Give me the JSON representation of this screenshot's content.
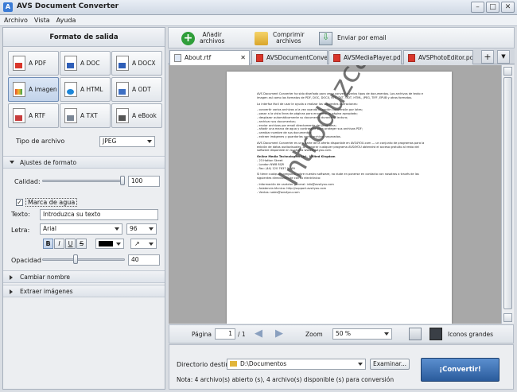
{
  "window": {
    "title": "AVS Document Converter"
  },
  "menu": [
    "Archivo",
    "Vista",
    "Ayuda"
  ],
  "left": {
    "title": "Formato de salida",
    "formats": [
      {
        "label": "A PDF",
        "icon": "pdf-icon"
      },
      {
        "label": "A DOC",
        "icon": "doc-icon"
      },
      {
        "label": "A DOCX",
        "icon": "docx-icon"
      },
      {
        "label": "A imagen",
        "icon": "image-icon"
      },
      {
        "label": "A HTML",
        "icon": "html-icon"
      },
      {
        "label": "A ODT",
        "icon": "odt-icon"
      },
      {
        "label": "A RTF",
        "icon": "rtf-icon"
      },
      {
        "label": "A TXT",
        "icon": "txt-icon"
      },
      {
        "label": "A eBook",
        "icon": "ebook-icon"
      }
    ],
    "active_format": "A imagen",
    "filetype_label": "Tipo de archivo",
    "filetype_value": "JPEG",
    "format_settings": "Ajustes de formato",
    "quality_label": "Calidad:",
    "quality_value": "100",
    "quality_level": 1.0,
    "watermark_label": "Marca de agua",
    "watermark_checked": true,
    "text_label": "Texto:",
    "text_value": "Introduzca su texto",
    "font_label": "Letra:",
    "font_value": "Arial",
    "font_size": "96",
    "bold": "B",
    "italic": "I",
    "underline": "U",
    "strike": "S",
    "opacity_label": "Opacidad",
    "opacity_value": "40",
    "opacity_level": 0.4,
    "rename": "Cambiar nombre",
    "extract": "Extraer imágenes"
  },
  "toolbar": {
    "add": "Añadir\narchivos",
    "compress": "Comprimir\narchivos",
    "email": "Enviar por email"
  },
  "tabs": [
    {
      "label": "About.rtf",
      "icon": "rtf"
    },
    {
      "label": "AVSDocumentConve...",
      "icon": "pdf"
    },
    {
      "label": "AVSMediaPlayer.pdf",
      "icon": "pdf"
    },
    {
      "label": "AVSPhotoEditor.pdf",
      "icon": "pdf"
    }
  ],
  "document": {
    "p1": "AVS Document Converter ha sido diseñado para ver y convertir varios tipos de documentos. Los archivos de texto e imagen así como los formatos de PDF, DOC, DOCX, RTF, TXT, ODT, HTML, JPEG, TIFF, EPUB y otros formatos.",
    "p2": "La interfaz fácil de usar le ayuda a realizar las siguientes operaciones:",
    "list": [
      "- convertir varios archivos a la vez usando la opción Conversión por lotes;",
      "- pasar a la vista línea de páginas para encontrar la página apropiada;",
      "- desplazar automáticamente su documento durante la lectura;",
      "- archivar sus documentos;",
      "- enviar archivos por email directamente del programa;",
      "- añadir una marca de agua y contraseña para proteger sus archivos PDF;",
      "- cambiar nombre de sus documentos;",
      "- extraer imágenes y guardarlas como archivos separados."
    ],
    "p3": "AVS Document Converter es una parte de la oferta disponible en AVS4YOU.com — un conjunto de programas para la edición de datos audiovisuales. Al comprar cualquier programa AVS4YOU obtendrá el acceso gratuito al resto del software disponible en la página www.avs4you.com.",
    "company": "Online Media Technologies Ltd., United Kingdom",
    "address": [
      "- 23 Hatton Street",
      "- London NW8 8QR",
      "- Fax: (44) 120 7637 04 69"
    ],
    "p4": "Si tiene cualquier pregunta sobre nuestro software, no dude en ponerse en contacto con nosotros a través de las siguientes direcciones de correo electrónico:",
    "contacts": [
      "- Información de carácter general: info@avs4you.com",
      "- Asistencia técnica: http://support.avs4you.com",
      "- Ventas: sales@avs4you.com"
    ],
    "watermark": "Introduzca su texto"
  },
  "nav": {
    "page_label": "Página",
    "page_value": "1",
    "page_total": "/ 1",
    "zoom_label": "Zoom",
    "zoom_value": "50 %",
    "view_label": "Iconos grandes"
  },
  "bottom": {
    "dir_label": "Directorio destino:",
    "dir_value": "D:\\Documentos",
    "browse": "Examinar...",
    "note": "Nota: 4 archivo(s) abierto (s), 4 archivo(s) disponible (s) para conversión",
    "convert": "¡Convertir!"
  }
}
